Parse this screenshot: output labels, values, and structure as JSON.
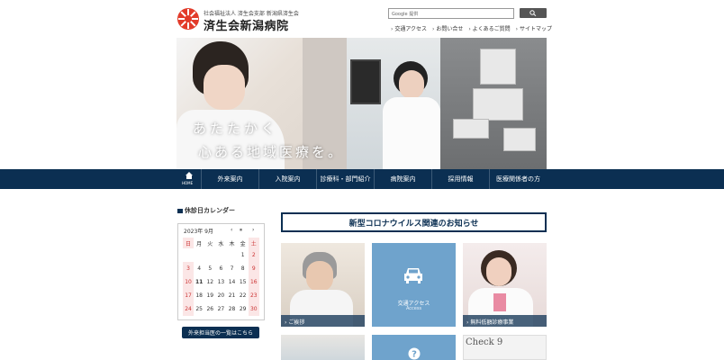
{
  "header": {
    "logo_sub": "社会福祉法人 済生会支部 新潟県済生会",
    "logo_title": "済生会新潟病院",
    "search_placeholder": "Google 提供",
    "util_links": [
      "交通アクセス",
      "お問い合せ",
      "よくあるご質問",
      "サイトマップ"
    ]
  },
  "hero": {
    "copy1": "あたたかく",
    "copy2": "心ある地域医療を。"
  },
  "nav": {
    "home": "HOME",
    "items": [
      "外来案内",
      "入院案内",
      "診療科・部門紹介",
      "病院案内",
      "採用情報",
      "医療関係者の方"
    ]
  },
  "calendar": {
    "heading": "休診日カレンダー",
    "month": "2023年 9月",
    "prev": "‹",
    "pause": "⏸",
    "next": "›",
    "weekdays": [
      "日",
      "月",
      "火",
      "水",
      "木",
      "金",
      "土"
    ],
    "weeks": [
      [
        "",
        "",
        "",
        "",
        "",
        "1",
        "2"
      ],
      [
        "3",
        "4",
        "5",
        "6",
        "7",
        "8",
        "9"
      ],
      [
        "10",
        "11",
        "12",
        "13",
        "14",
        "15",
        "16"
      ],
      [
        "17",
        "18",
        "19",
        "20",
        "21",
        "22",
        "23"
      ],
      [
        "24",
        "25",
        "26",
        "27",
        "28",
        "29",
        "30"
      ]
    ],
    "button": "外来担当医の一覧はこちら"
  },
  "main": {
    "covid_banner": "新型コロナウイルス関連のお知らせ",
    "tiles": [
      {
        "caption": "ご挨拶"
      },
      {
        "title": "交通アクセス",
        "subtitle": "Access"
      },
      {
        "caption": "無料低額診療事業"
      }
    ],
    "bottom_tiles": [
      "",
      "?",
      "Check 9"
    ]
  },
  "colors": {
    "navy": "#0b2f52",
    "access_blue": "#6fa3cc",
    "holiday_pink": "#fbe6e6"
  }
}
